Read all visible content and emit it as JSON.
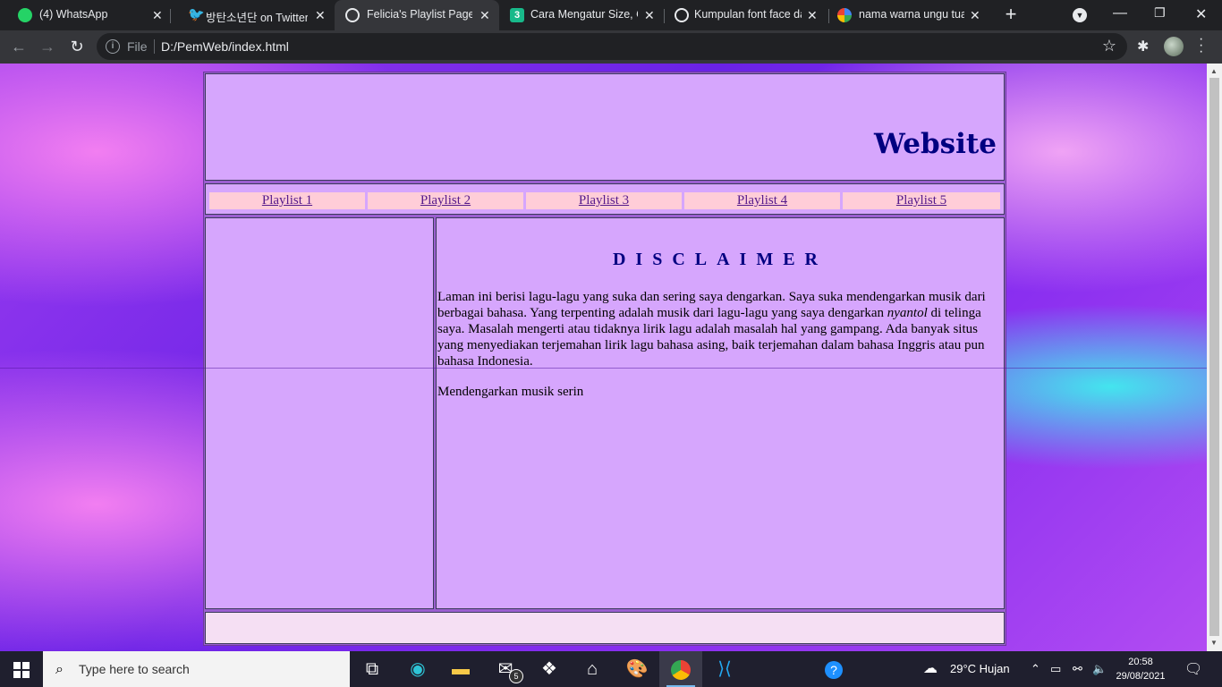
{
  "browser": {
    "tabs": [
      {
        "label": "(4) WhatsApp",
        "icon": "whatsapp-icon",
        "active": false
      },
      {
        "label": "방탄소년단 on Twitter",
        "icon": "twitter-icon",
        "active": false
      },
      {
        "label": "Felicia's Playlist Page",
        "icon": "globe-icon",
        "active": true
      },
      {
        "label": "Cara Mengatur Size, C",
        "icon": "codepolitan-icon",
        "active": false
      },
      {
        "label": "Kumpulan font face da",
        "icon": "globe-icon",
        "active": false
      },
      {
        "label": "nama warna ungu tua",
        "icon": "google-icon",
        "active": false
      }
    ],
    "address": {
      "scheme": "File",
      "url": "D:/PemWeb/index.html"
    }
  },
  "page": {
    "marquee_text": "Website Playlist",
    "nav_links": [
      "Playlist 1",
      "Playlist 2",
      "Playlist 3",
      "Playlist 4",
      "Playlist 5"
    ],
    "disclaimer": {
      "title": "DISCLAIMER",
      "p1_before": "Laman ini berisi lagu-lagu yang suka dan sering saya dengarkan. Saya suka mendengarkan musik dari berbagai bahasa. Yang terpenting adalah musik dari lagu-lagu yang saya dengarkan ",
      "p1_italic": "nyantol",
      "p1_after": " di telinga saya. Masalah mengerti atau tidaknya lirik lagu adalah masalah hal yang gampang. Ada banyak situs yang menyediakan terjemahan lirik lagu bahasa asing, baik terjemahan dalam bahasa Inggris atau pun bahasa Indonesia.",
      "p2": "Mendengarkan musik serin"
    },
    "colors": {
      "cell_bg": "#d6a6fd",
      "nav_bg": "#ffcdd8",
      "title_color": "#000080",
      "footer_bg": "#f5dff3"
    }
  },
  "taskbar": {
    "search_placeholder": "Type here to search",
    "mail_badge": "5",
    "weather": "29°C  Hujan",
    "time": "20:58",
    "date": "29/08/2021"
  }
}
